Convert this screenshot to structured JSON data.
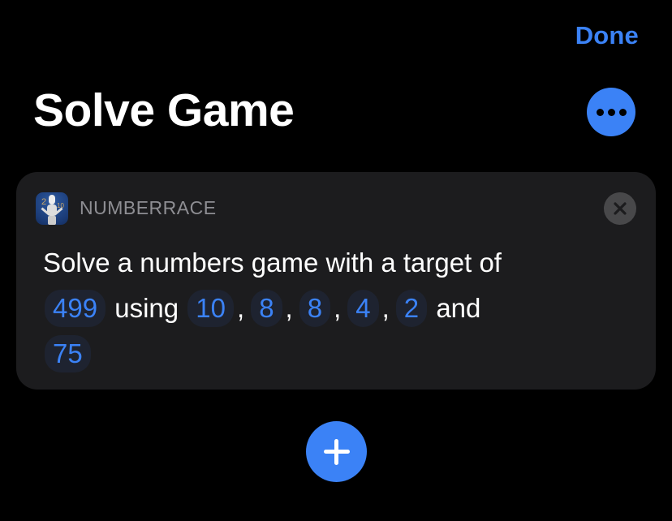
{
  "header": {
    "done_label": "Done",
    "title": "Solve Game",
    "more_icon": "ellipsis-icon"
  },
  "action_card": {
    "app_name": "NUMBERRACE",
    "app_icon": "numberrace-app-icon",
    "close_icon": "close-icon",
    "sentence": {
      "prefix": "Solve a numbers game with a target of",
      "target": "499",
      "using_word": "using",
      "numbers": [
        "10",
        "8",
        "8",
        "4",
        "2"
      ],
      "separator": ",",
      "and_word": "and",
      "last_number": "75"
    }
  },
  "add_button": {
    "icon": "plus-icon"
  },
  "colors": {
    "accent": "#3b82f6",
    "background": "#000000",
    "card": "#1c1c1e",
    "secondary_text": "#8e8e93"
  }
}
